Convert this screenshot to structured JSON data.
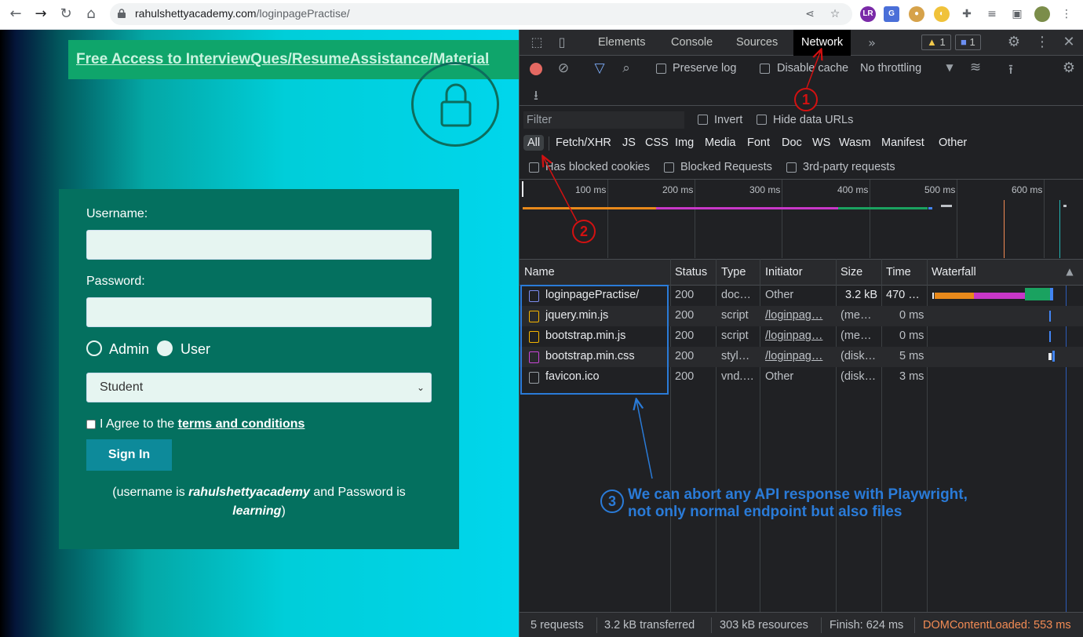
{
  "browser": {
    "url_domain": "rahulshettyacademy.com",
    "url_path": "/loginpagePractise/",
    "extensions": [
      "LR",
      "G",
      "cookie",
      "translate"
    ]
  },
  "page": {
    "banner_link": "Free Access to InterviewQues/ResumeAssistance/Material",
    "username_label": "Username:",
    "password_label": "Password:",
    "radio_admin": "Admin",
    "radio_user": "User",
    "select_value": "Student",
    "agree_prefix": "I Agree to the ",
    "terms_link": "terms and conditions",
    "signin_label": "Sign In",
    "info_part1": "(username is ",
    "info_user": "rahulshettyacademy",
    "info_part2": " and Password is ",
    "info_pass": "learning",
    "info_part3": ")"
  },
  "devtools": {
    "tabs": [
      "Elements",
      "Console",
      "Sources",
      "Network"
    ],
    "active_tab": "Network",
    "warnings_count": "1",
    "messages_count": "1",
    "toolbar": {
      "preserve_log": "Preserve log",
      "disable_cache": "Disable cache",
      "throttling": "No throttling"
    },
    "filter_placeholder": "Filter",
    "invert": "Invert",
    "hide_data_urls": "Hide data URLs",
    "type_filters": [
      "All",
      "Fetch/XHR",
      "JS",
      "CSS",
      "Img",
      "Media",
      "Font",
      "Doc",
      "WS",
      "Wasm",
      "Manifest",
      "Other"
    ],
    "blocked_cookies": "Has blocked cookies",
    "blocked_requests": "Blocked Requests",
    "third_party": "3rd-party requests",
    "timeline_ticks": [
      "100 ms",
      "200 ms",
      "300 ms",
      "400 ms",
      "500 ms",
      "600 ms"
    ],
    "columns": [
      "Name",
      "Status",
      "Type",
      "Initiator",
      "Size",
      "Time",
      "Waterfall"
    ],
    "requests": [
      {
        "name": "loginpagePractise/",
        "status": "200",
        "type": "doc…",
        "initiator": "Other",
        "size": "3.2 kB",
        "time": "470 …",
        "icon_color": "#7b8cf0"
      },
      {
        "name": "jquery.min.js",
        "status": "200",
        "type": "script",
        "initiator": "/loginpag…",
        "size": "(me…",
        "time": "0 ms",
        "icon_color": "#f4b400"
      },
      {
        "name": "bootstrap.min.js",
        "status": "200",
        "type": "script",
        "initiator": "/loginpag…",
        "size": "(me…",
        "time": "0 ms",
        "icon_color": "#f4b400"
      },
      {
        "name": "bootstrap.min.css",
        "status": "200",
        "type": "styl…",
        "initiator": "/loginpag…",
        "size": "(disk…",
        "time": "5 ms",
        "icon_color": "#c845d6"
      },
      {
        "name": "favicon.ico",
        "status": "200",
        "type": "vnd.…",
        "initiator": "Other",
        "size": "(disk…",
        "time": "3 ms",
        "icon_color": "#9aa0a6"
      }
    ],
    "statusbar": {
      "requests": "5 requests",
      "transferred": "3.2 kB transferred",
      "resources": "303 kB resources",
      "finish": "Finish: 624 ms",
      "dcl": "DOMContentLoaded: 553 ms"
    }
  },
  "annotations": {
    "step1": "1",
    "step2": "2",
    "step3": "3",
    "note_line1": "We can abort any API response with Playwright,",
    "note_line2": "not only normal endpoint but also files"
  },
  "colors": {
    "annotation_red": "#d31111",
    "annotation_blue": "#2a7bd8",
    "dcl_orange": "#f28b54"
  }
}
